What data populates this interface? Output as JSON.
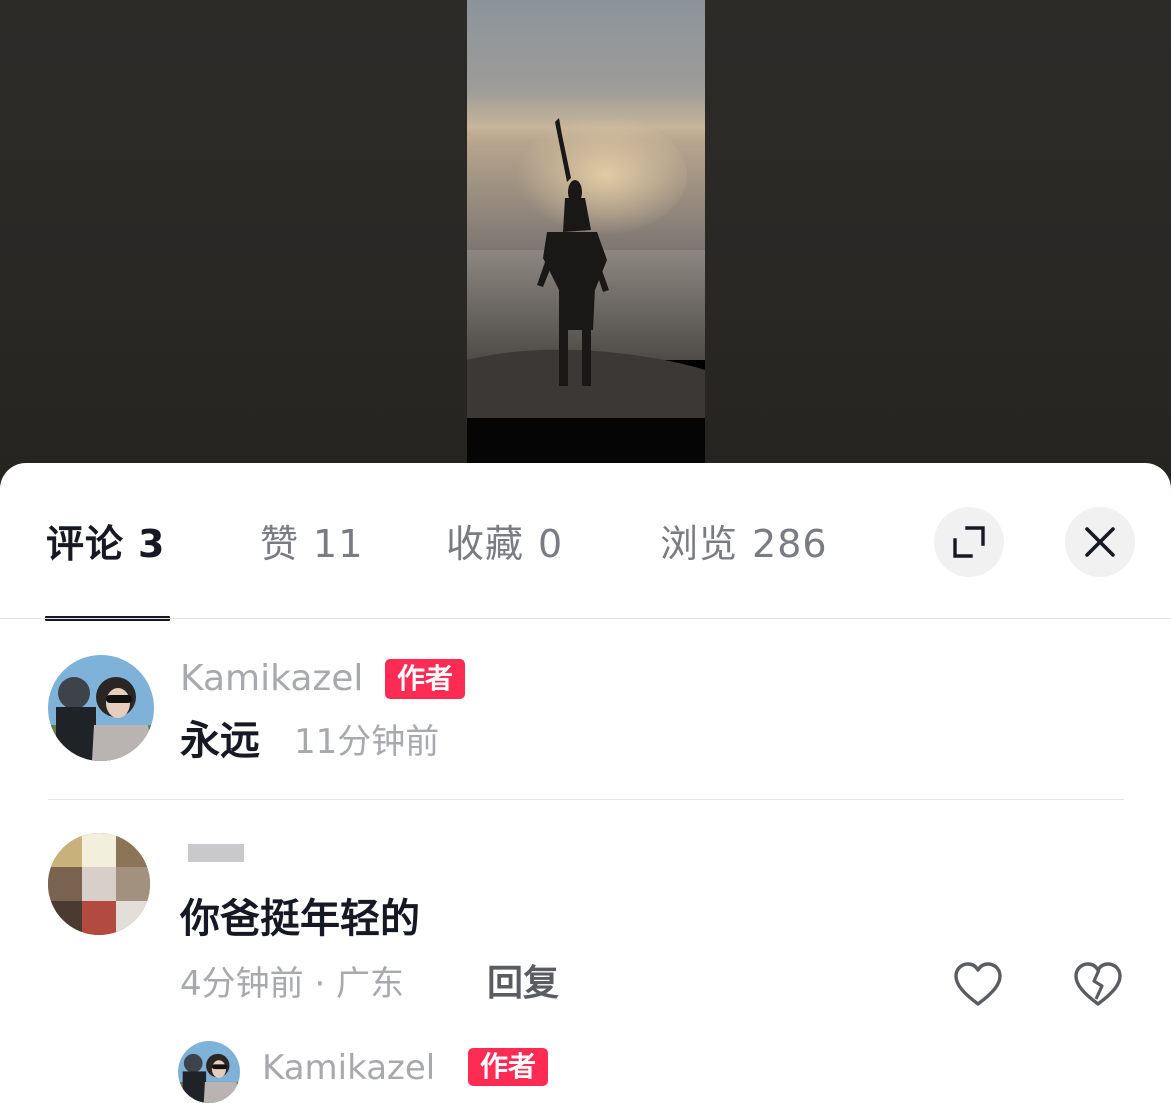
{
  "tabs": {
    "comments": {
      "label": "评论",
      "count": "3"
    },
    "likes": {
      "label": "赞",
      "count": "11"
    },
    "favorites": {
      "label": "收藏",
      "count": "0"
    },
    "views": {
      "label": "浏览",
      "count": "286"
    }
  },
  "controls": {
    "expand_icon": "expand-icon",
    "close_icon": "close-icon"
  },
  "comments": [
    {
      "username": "Kamikazel",
      "badge": "作者",
      "text": "永远",
      "time": "11分钟前"
    },
    {
      "text": "你爸挺年轻的",
      "time_location": "4分钟前 · 广东",
      "reply_label": "回复",
      "like_icon": "heart-outline-icon",
      "dislike_icon": "broken-heart-icon"
    }
  ],
  "reply": {
    "username": "Kamikazel",
    "badge": "作者"
  },
  "colors": {
    "badge": "#fe2c55",
    "text_primary": "#161823",
    "text_secondary": "#a8a9ad"
  }
}
